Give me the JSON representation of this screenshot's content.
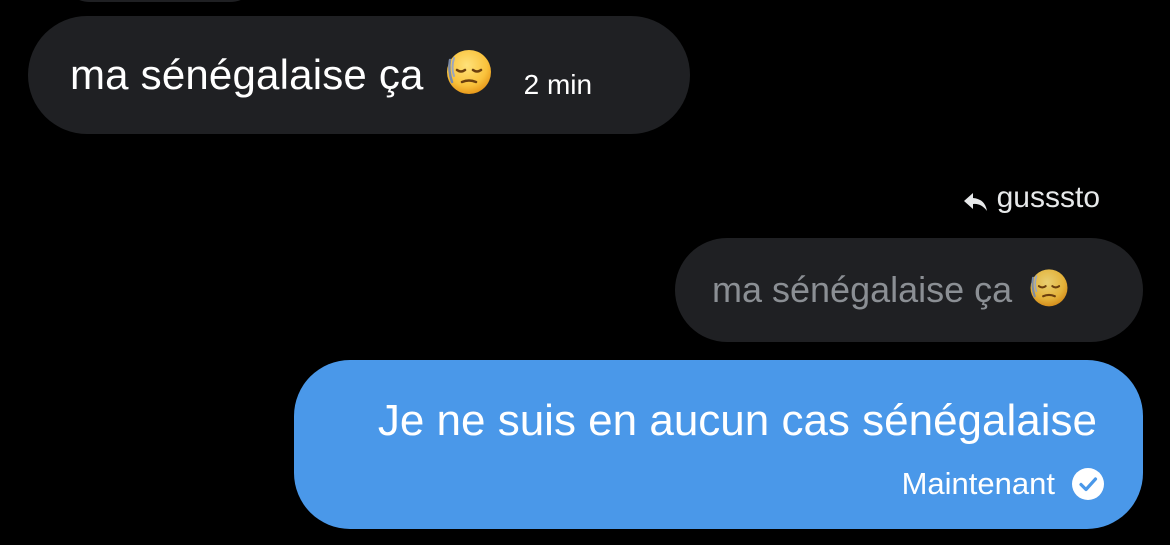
{
  "conversation": {
    "received_message": {
      "text": "ma sénégalaise ça",
      "emoji": "relieved-face-with-bandage-sweat-emoji",
      "time": "2 min"
    },
    "reply_context": {
      "icon": "reply-arrow-icon",
      "username": "gusssto",
      "quoted_text": "ma sénégalaise ça",
      "quoted_emoji": "relieved-face-with-bandage-sweat-emoji"
    },
    "sent_message": {
      "text": "Je ne suis en aucun cas sénégalaise",
      "status": "Maintenant",
      "status_icon": "check-circle-icon"
    }
  },
  "colors": {
    "background": "#000000",
    "received_bubble": "#1f2023",
    "sent_bubble": "#4a98e9",
    "quoted_text": "#8b8f94"
  }
}
